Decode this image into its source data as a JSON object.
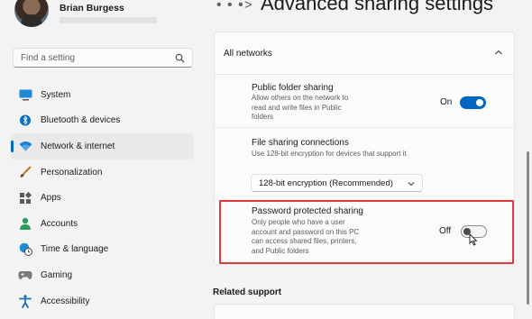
{
  "user": {
    "name": "Brian Burgess"
  },
  "search": {
    "placeholder": "Find a setting",
    "icon": "search-icon"
  },
  "nav": {
    "active": "Network & internet",
    "items": [
      {
        "label": "System",
        "icon": "monitor-icon"
      },
      {
        "label": "Bluetooth & devices",
        "icon": "bluetooth-icon"
      },
      {
        "label": "Network & internet",
        "icon": "wifi-icon"
      },
      {
        "label": "Personalization",
        "icon": "brush-icon"
      },
      {
        "label": "Apps",
        "icon": "apps-icon"
      },
      {
        "label": "Accounts",
        "icon": "person-icon"
      },
      {
        "label": "Time & language",
        "icon": "globe-clock-icon"
      },
      {
        "label": "Gaming",
        "icon": "gamepad-icon"
      },
      {
        "label": "Accessibility",
        "icon": "accessibility-icon"
      }
    ]
  },
  "header": {
    "dots": "• • •",
    "chevron": ">",
    "title": "Advanced sharing settings"
  },
  "section": {
    "title": "All networks",
    "public_folder": {
      "title": "Public folder sharing",
      "desc1": "Allow others on the network to",
      "desc2": "read and write files in Public",
      "desc3": "folders",
      "state": "On"
    },
    "file_sharing": {
      "title": "File sharing connections",
      "desc": "Use 128-bit encryption for devices that support it",
      "selected": "128-bit encryption (Recommended)"
    },
    "password_sharing": {
      "title": "Password protected sharing",
      "desc1": "Only people who have a user",
      "desc2": "account and password on this PC",
      "desc3": "can access shared files, printers,",
      "desc4": "and Public folders",
      "state": "Off"
    }
  },
  "related": {
    "title": "Related support"
  },
  "colors": {
    "accent": "#0067c0",
    "highlight": "#e0393e"
  }
}
